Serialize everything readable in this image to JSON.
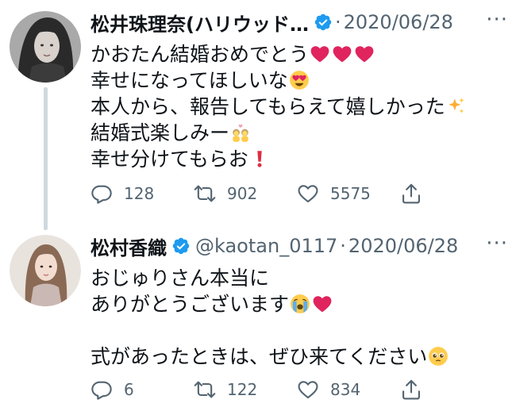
{
  "tweets": [
    {
      "display_name": "松井珠理奈(ハリウッド…",
      "handle": "",
      "date": "2020/06/28",
      "dot": "·",
      "avatar": "avatar-woman-dark-hair",
      "lines": [
        {
          "text": "かおたん結婚おめでとう",
          "emojis": [
            "red-heart",
            "red-heart",
            "red-heart"
          ]
        },
        {
          "text": "幸せになってほしいな",
          "emojis": [
            "heart-eyes"
          ]
        },
        {
          "text": "本人から、報告してもらえて嬉しかった",
          "emojis": [
            "sparkles"
          ]
        },
        {
          "text": "結婚式楽しみー",
          "emojis": [
            "celebrating-people"
          ]
        },
        {
          "text": "幸せ分けてもらお",
          "emojis": [
            "red-exclamation"
          ]
        }
      ],
      "counts": {
        "reply": "128",
        "retweet": "902",
        "like": "5575"
      }
    },
    {
      "display_name": "松村香織",
      "handle": "@kaotan_0117",
      "date": "2020/06/28",
      "dot": "·",
      "avatar": "avatar-woman-light-hair",
      "lines": [
        {
          "text": "おじゅりさん本当に",
          "emojis": []
        },
        {
          "text": "ありがとうございます",
          "emojis": [
            "crying-face",
            "red-heart"
          ]
        },
        {
          "text": "",
          "emojis": []
        },
        {
          "text": "式があったときは、ぜひ来てください",
          "emojis": [
            "pleading-face"
          ]
        }
      ],
      "counts": {
        "reply": "6",
        "retweet": "122",
        "like": "834"
      }
    }
  ],
  "icons": {
    "verified": "verified-badge-icon",
    "more": "more-options-icon",
    "reply": "reply-icon",
    "retweet": "retweet-icon",
    "like": "heart-outline-icon",
    "share": "share-icon"
  },
  "colors": {
    "verified": "#1d9bf0",
    "text": "#0f1419",
    "secondary": "#536471",
    "thread_line": "#cfd9de",
    "heart": "#e0245e"
  }
}
